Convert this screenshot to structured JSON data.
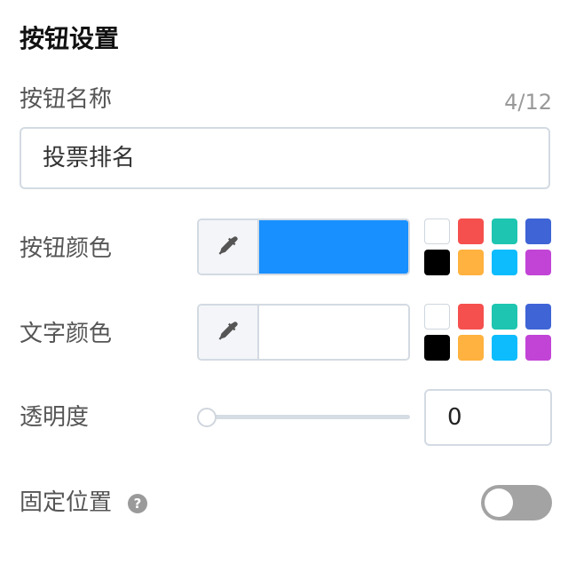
{
  "header": {
    "title": "按钮设置"
  },
  "button_name": {
    "label": "按钮名称",
    "value": "投票排名",
    "counter": "4/12"
  },
  "button_color": {
    "label": "按钮颜色",
    "current": "#1890ff",
    "picker_icon": "eyedropper-icon"
  },
  "text_color": {
    "label": "文字颜色",
    "current": "#ffffff",
    "picker_icon": "eyedropper-icon"
  },
  "presets": [
    "#ffffff",
    "#f5504e",
    "#1ec5b0",
    "#3f64d6",
    "#000000",
    "#ffb23f",
    "#0cbcfd",
    "#c244d6"
  ],
  "opacity": {
    "label": "透明度",
    "value": "0",
    "slider_fraction": 0
  },
  "fixed_position": {
    "label": "固定位置",
    "help_icon": "question-circle-icon",
    "enabled": false
  }
}
